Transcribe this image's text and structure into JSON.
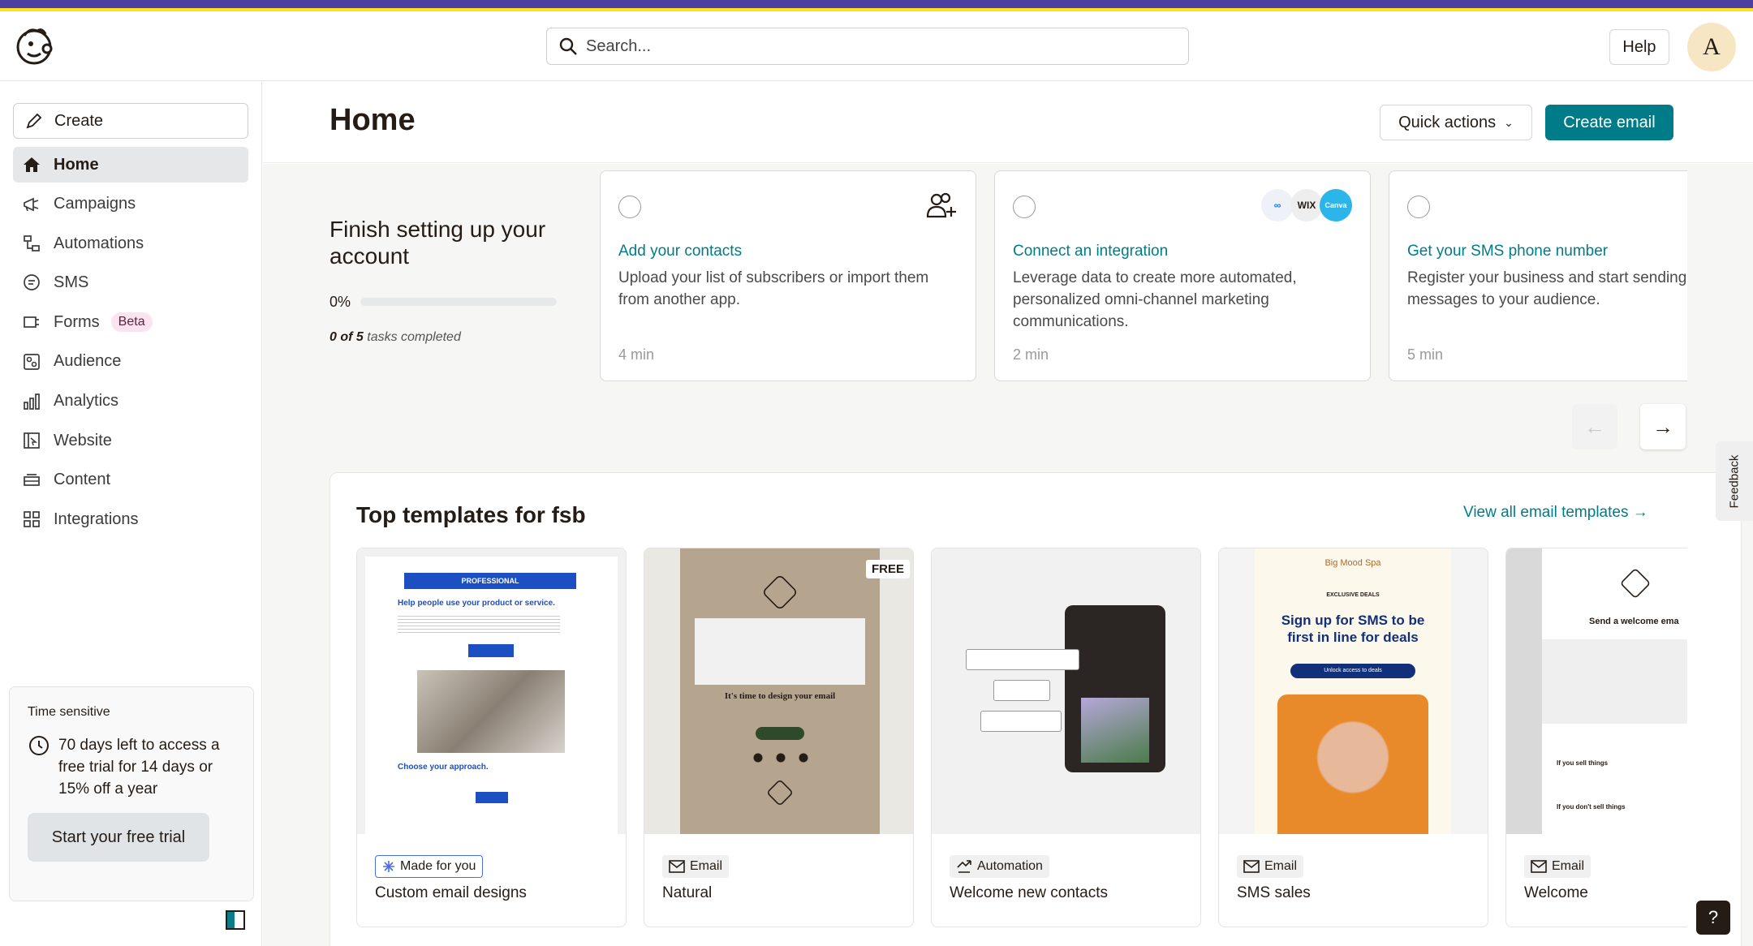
{
  "search": {
    "placeholder": "Search..."
  },
  "header": {
    "help_label": "Help",
    "avatar_initial": "A"
  },
  "sidebar": {
    "create_label": "Create",
    "items": [
      {
        "label": "Home",
        "icon": "home-icon"
      },
      {
        "label": "Campaigns",
        "icon": "megaphone-icon"
      },
      {
        "label": "Automations",
        "icon": "automation-icon"
      },
      {
        "label": "SMS",
        "icon": "sms-icon"
      },
      {
        "label": "Forms",
        "icon": "forms-icon",
        "badge": "Beta"
      },
      {
        "label": "Audience",
        "icon": "audience-icon"
      },
      {
        "label": "Analytics",
        "icon": "analytics-icon"
      },
      {
        "label": "Website",
        "icon": "website-icon"
      },
      {
        "label": "Content",
        "icon": "content-icon"
      },
      {
        "label": "Integrations",
        "icon": "integrations-icon"
      }
    ],
    "trial": {
      "label": "Time sensitive",
      "text": "70 days left to access a free trial for 14 days or 15% off a year",
      "button": "Start your free trial"
    }
  },
  "main": {
    "title": "Home",
    "quick_actions": "Quick actions",
    "create_email": "Create email",
    "setup": {
      "title": "Finish setting up your account",
      "progress_pct": "0%",
      "progress_value": 0,
      "tasks_count": "0 of 5",
      "tasks_suffix": " tasks completed",
      "cards": [
        {
          "title": "Add your contacts",
          "desc": "Upload your list of subscribers or import them from another app.",
          "time": "4 min"
        },
        {
          "title": "Connect an integration",
          "desc": "Leverage data to create more automated, personalized omni-channel marketing communications.",
          "time": "2 min",
          "brands": [
            "Meta",
            "WIX",
            "Canva"
          ]
        },
        {
          "title": "Get your SMS phone number",
          "desc": "Register your business and start sending messages to your audience.",
          "time": "5 min"
        }
      ]
    },
    "templates": {
      "title": "Top templates for fsb",
      "view_all": "View all email templates →",
      "items": [
        {
          "badge": "Made for you",
          "name": "Custom email designs"
        },
        {
          "badge": "Email",
          "name": "Natural",
          "tag": "FREE"
        },
        {
          "badge": "Automation",
          "name": "Welcome new contacts"
        },
        {
          "badge": "Email",
          "name": "SMS sales"
        },
        {
          "badge": "Email",
          "name": "Welcome"
        }
      ],
      "thumb_text": {
        "t1_header": "PROFESSIONAL",
        "t1_headline": "Help people use your product or service.",
        "t1_sub": "Choose your approach.",
        "t2_headline": "It's time to design your email",
        "t4_brand": "Big Mood Spa",
        "t4_eyebrow": "EXCLUSIVE DEALS",
        "t4_headline": "Sign up for SMS to be first in line for deals",
        "t4_cta": "Unlock access to deals",
        "t5_headline": "Send a welcome ema",
        "t5_s1": "If you sell things",
        "t5_s2": "If you don't sell things"
      }
    }
  },
  "feedback_label": "Feedback",
  "help_fab": "?"
}
